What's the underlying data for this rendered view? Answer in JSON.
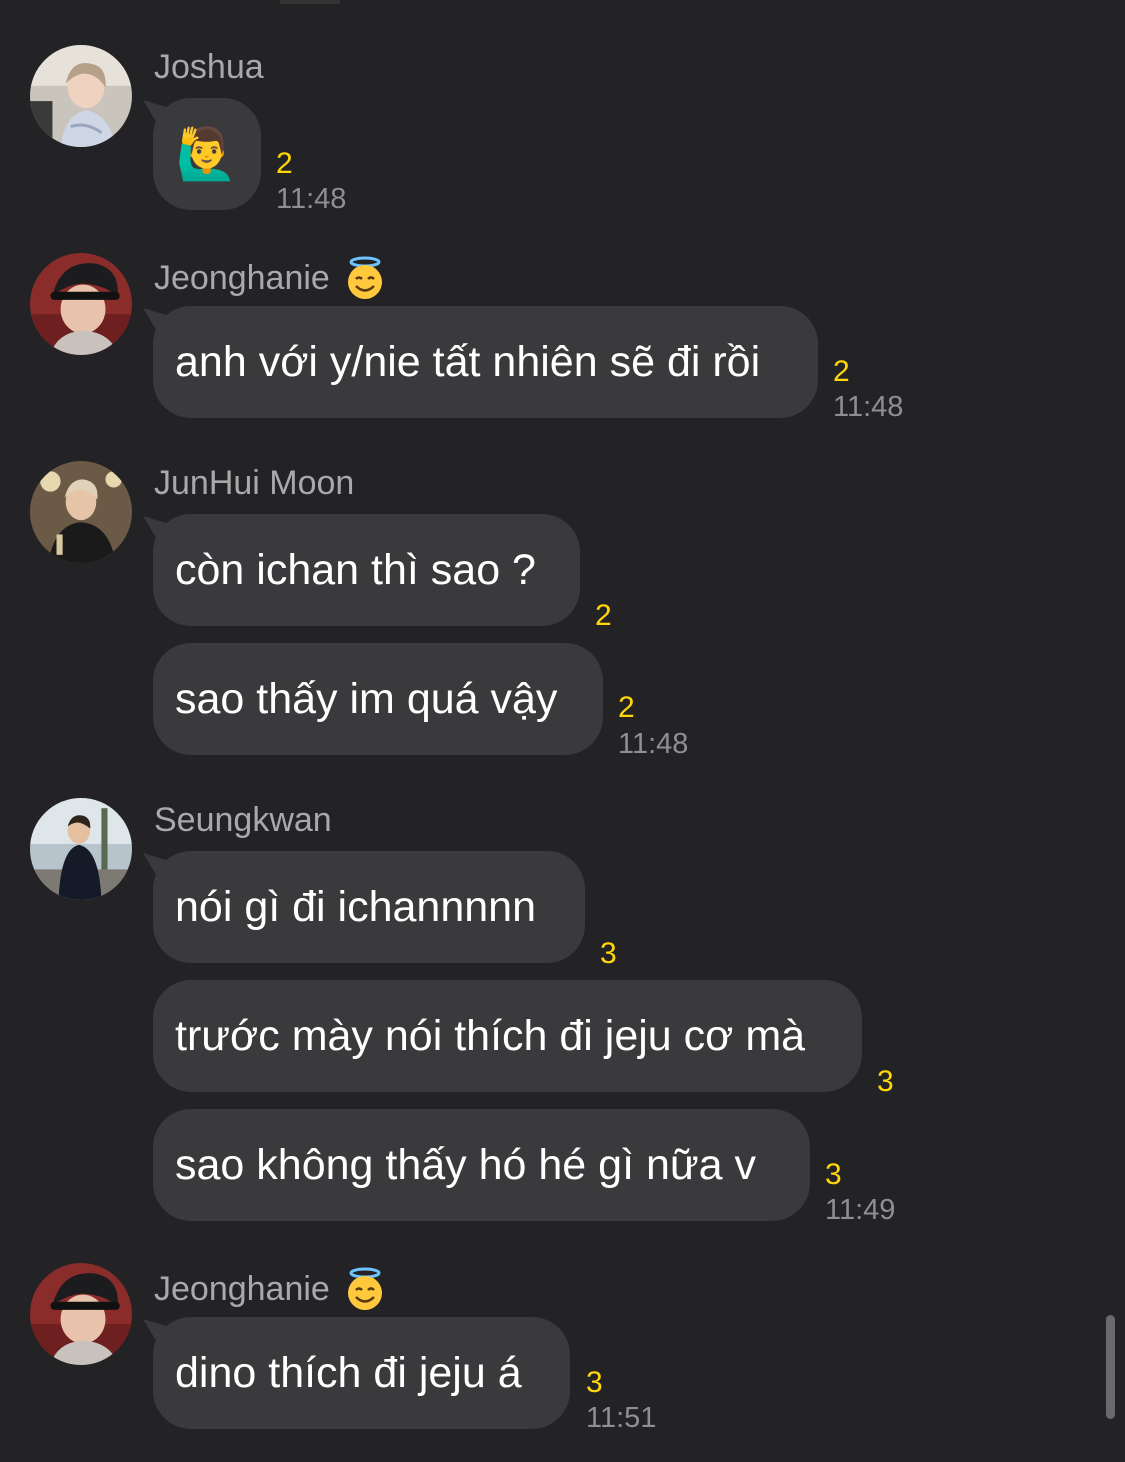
{
  "colors": {
    "background": "#232325",
    "bubble": "#3a3a3c",
    "sender_name": "#a9a9ab",
    "unread_count": "#ffd60a",
    "timestamp": "#8e8e93"
  },
  "messages": [
    {
      "sender": "Joshua",
      "avatar": "avatar-joshua",
      "bubbles": [
        {
          "text": "🙋‍♂️",
          "unread": "2",
          "time": "11:48"
        }
      ]
    },
    {
      "sender": "Jeonghanie",
      "sender_emoji": "angel-face-icon",
      "avatar": "avatar-jeonghanie",
      "bubbles": [
        {
          "text": "anh với y/nie tất nhiên sẽ đi rồi",
          "unread": "2",
          "time": "11:48"
        }
      ]
    },
    {
      "sender": "JunHui Moon",
      "avatar": "avatar-junhui",
      "bubbles": [
        {
          "text": "còn ichan thì sao ?",
          "unread": "2",
          "time": ""
        },
        {
          "text": "sao thấy im quá vậy",
          "unread": "2",
          "time": "11:48"
        }
      ]
    },
    {
      "sender": "Seungkwan",
      "avatar": "avatar-seungkwan",
      "bubbles": [
        {
          "text": "nói gì đi ichannnnn",
          "unread": "3",
          "time": ""
        },
        {
          "text": "trước mày nói thích đi jeju cơ mà",
          "unread": "3",
          "time": ""
        },
        {
          "text": "sao không thấy hó hé gì nữa v",
          "unread": "3",
          "time": "11:49"
        }
      ]
    },
    {
      "sender": "Jeonghanie",
      "sender_emoji": "angel-face-icon",
      "avatar": "avatar-jeonghanie",
      "bubbles": [
        {
          "text": "dino thích đi jeju á",
          "unread": "3",
          "time": "11:51"
        }
      ]
    }
  ]
}
